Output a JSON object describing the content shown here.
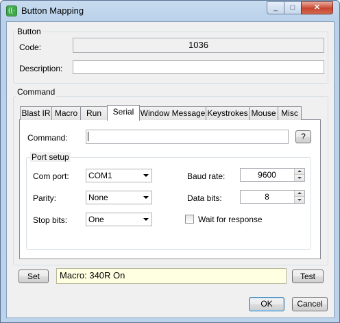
{
  "window": {
    "title": "Button Mapping",
    "icon": "remote-signal-icon",
    "controls": {
      "minimize": "_",
      "maximize": "□",
      "close": "✕"
    }
  },
  "button_group": {
    "label": "Button",
    "code_label": "Code:",
    "code_value": "1036",
    "description_label": "Description:",
    "description_value": ""
  },
  "command_group": {
    "label": "Command",
    "tabs": [
      {
        "label": "Blast IR"
      },
      {
        "label": "Macro"
      },
      {
        "label": "Run"
      },
      {
        "label": "Serial",
        "selected": true
      },
      {
        "label": "Window Message"
      },
      {
        "label": "Keystrokes"
      },
      {
        "label": "Mouse"
      },
      {
        "label": "Misc"
      }
    ],
    "serial": {
      "command_label": "Command:",
      "command_value": "",
      "help_label": "?",
      "port_setup": {
        "label": "Port setup",
        "com_port_label": "Com port:",
        "com_port_value": "COM1",
        "parity_label": "Parity:",
        "parity_value": "None",
        "stop_bits_label": "Stop bits:",
        "stop_bits_value": "One",
        "baud_rate_label": "Baud rate:",
        "baud_rate_value": "9600",
        "data_bits_label": "Data bits:",
        "data_bits_value": "8",
        "wait_label": "Wait for response",
        "wait_checked": false
      }
    }
  },
  "bottom": {
    "set_label": "Set",
    "status_text": "Macro: 340R On",
    "test_label": "Test",
    "ok_label": "OK",
    "cancel_label": "Cancel"
  },
  "colors": {
    "titlebar": "#b9d1ea",
    "close_button": "#c7452f",
    "status_background": "#ffffe1",
    "dialog_background": "#f0f0f0"
  }
}
